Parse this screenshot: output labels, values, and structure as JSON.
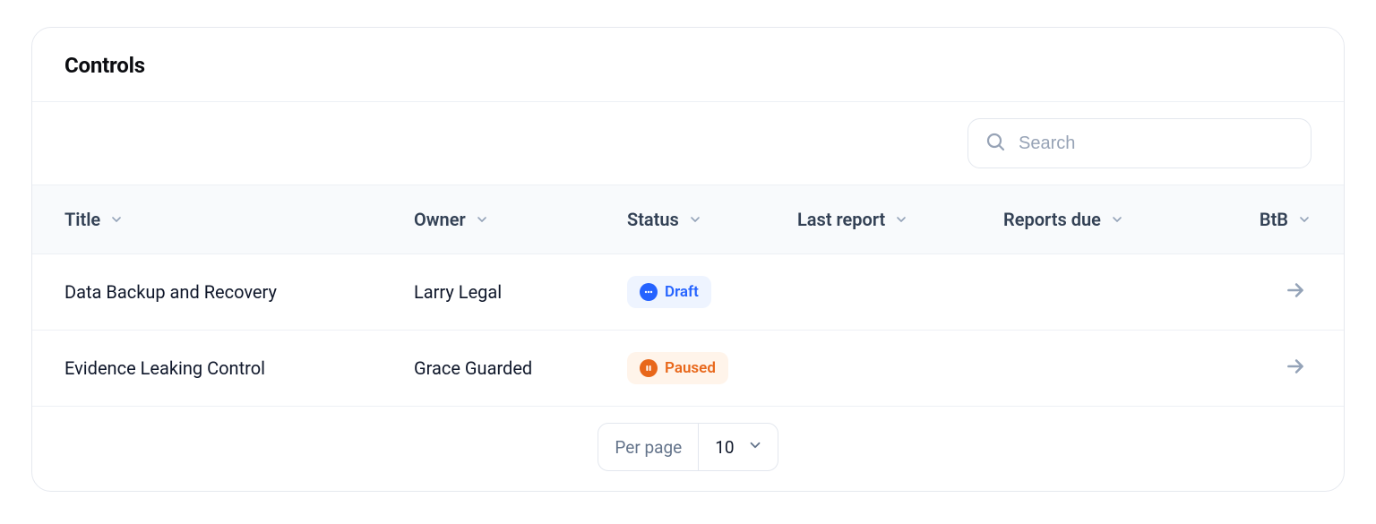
{
  "panel": {
    "title": "Controls"
  },
  "search": {
    "placeholder": "Search",
    "value": ""
  },
  "columns": {
    "title": "Title",
    "owner": "Owner",
    "status": "Status",
    "last_report": "Last report",
    "reports_due": "Reports due",
    "btb": "BtB"
  },
  "rows": [
    {
      "title": "Data Backup and Recovery",
      "owner": "Larry Legal",
      "status": {
        "label": "Draft",
        "kind": "draft"
      },
      "last_report": "",
      "reports_due": "",
      "btb": ""
    },
    {
      "title": "Evidence Leaking Control",
      "owner": "Grace Guarded",
      "status": {
        "label": "Paused",
        "kind": "paused"
      },
      "last_report": "",
      "reports_due": "",
      "btb": ""
    }
  ],
  "pagination": {
    "label": "Per page",
    "value": "10"
  }
}
